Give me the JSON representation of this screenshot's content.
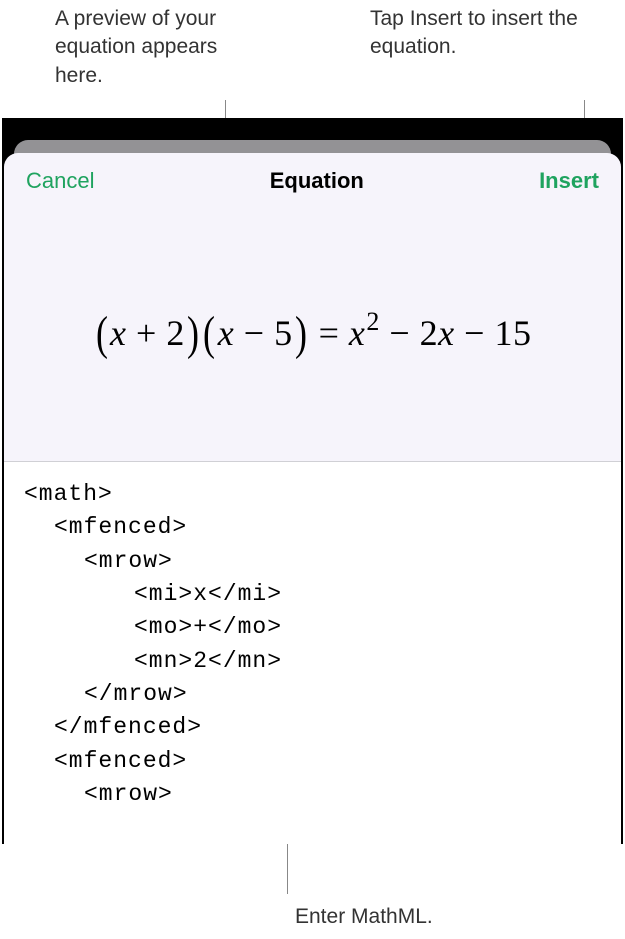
{
  "callouts": {
    "topLeft": "A preview of your equation appears here.",
    "topRight": "Tap Insert to insert the equation.",
    "bottom": "Enter MathML."
  },
  "modal": {
    "cancel": "Cancel",
    "title": "Equation",
    "insert": "Insert"
  },
  "equation": {
    "lparen1": "(",
    "x1": "x",
    "plus1": " + ",
    "two": "2",
    "rparen1": ")",
    "lparen2": "(",
    "x2": "x",
    "minus1": " − ",
    "five": "5",
    "rparen2": ")",
    "equals": " = ",
    "x3": "x",
    "sq": "2",
    "minus2": " − ",
    "twox": "2",
    "x4": "x",
    "minus3": " − ",
    "fifteen": "15"
  },
  "code": {
    "l1": "<math>",
    "l2": "<mfenced>",
    "l3": "<mrow>",
    "l4": "<mi>x</mi>",
    "l5": "<mo>+</mo>",
    "l6": "<mn>2</mn>",
    "l7": "</mrow>",
    "l8": "</mfenced>",
    "l9": "<mfenced>",
    "l10": "<mrow>"
  }
}
